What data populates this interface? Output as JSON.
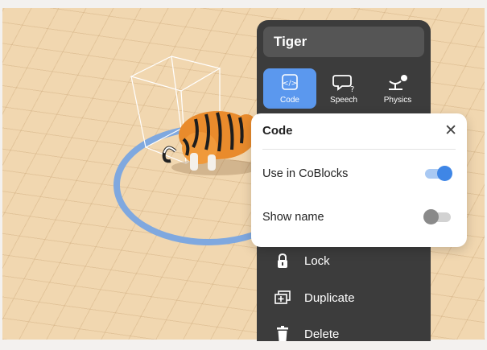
{
  "object_panel": {
    "title": "Tiger",
    "tabs": [
      {
        "label": "Code",
        "icon": "code-icon",
        "active": true
      },
      {
        "label": "Speech",
        "icon": "speech-bubble-icon",
        "active": false
      },
      {
        "label": "Physics",
        "icon": "physics-icon",
        "active": false
      }
    ],
    "menu": [
      {
        "label": "Lock",
        "icon": "lock-icon"
      },
      {
        "label": "Duplicate",
        "icon": "duplicate-icon"
      },
      {
        "label": "Delete",
        "icon": "trash-icon"
      }
    ]
  },
  "code_popover": {
    "title": "Code",
    "close_icon": "close-icon",
    "options": [
      {
        "label": "Use in CoBlocks",
        "enabled": true
      },
      {
        "label": "Show name",
        "enabled": false
      }
    ]
  },
  "colors": {
    "panel_bg": "#3c3c3c",
    "accent": "#3f86e6",
    "ground": "#f1d7b0",
    "selection_ring": "#7fa8df"
  }
}
